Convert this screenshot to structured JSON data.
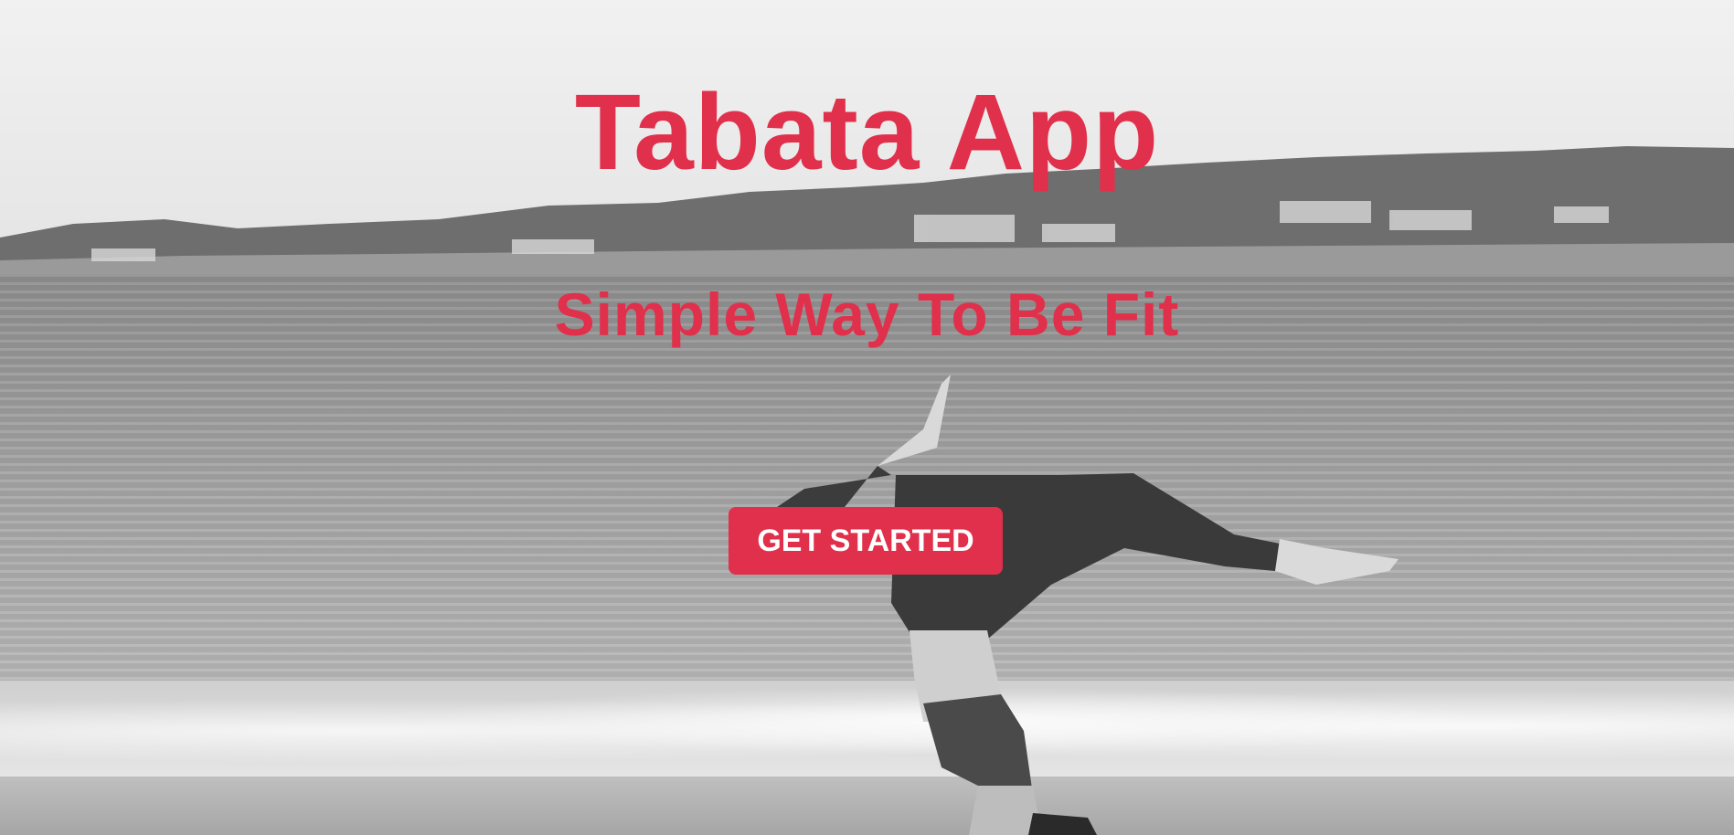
{
  "hero": {
    "title": "Tabata App",
    "subtitle": "Simple Way To Be Fit",
    "cta_label": "GET STARTED",
    "background_image": "grayscale-beach-gymnast-photo"
  },
  "colors": {
    "accent": "#e0304b",
    "button_text": "#ffffff"
  }
}
